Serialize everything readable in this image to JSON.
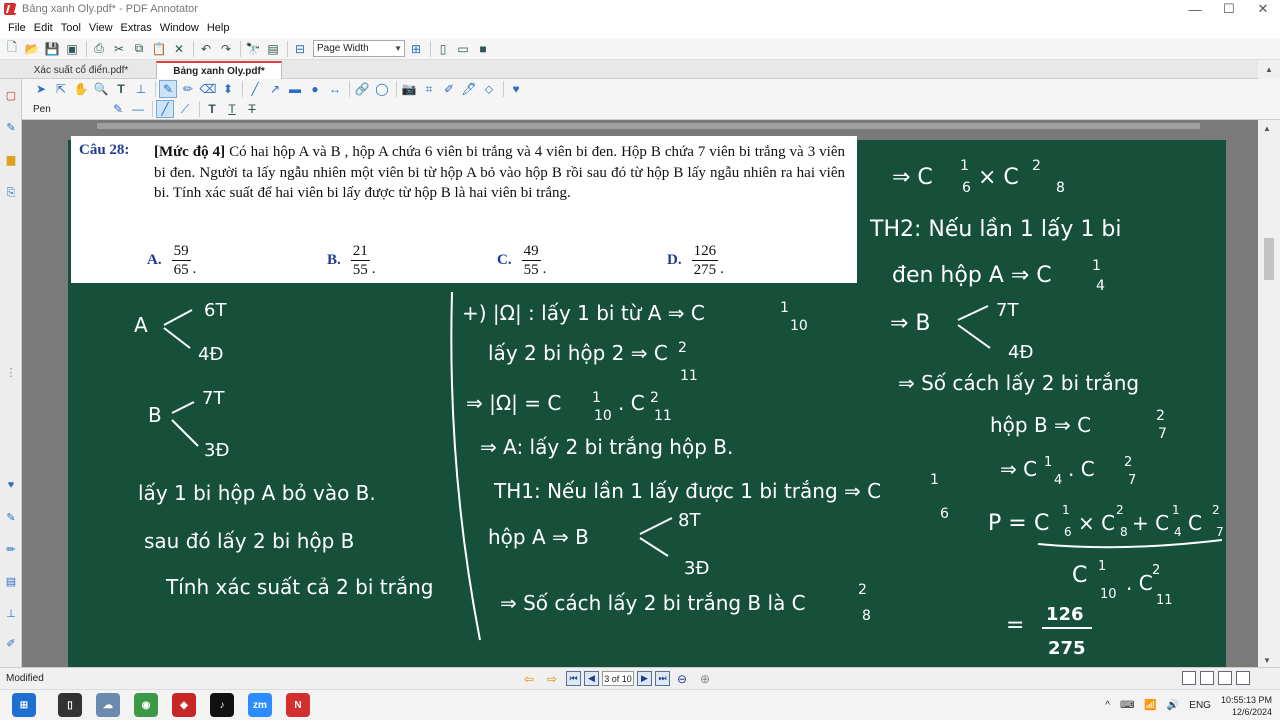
{
  "window": {
    "title": "Bảng xanh Oly.pdf* - PDF Annotator",
    "controls": [
      "—",
      "☐",
      "✕"
    ]
  },
  "menu": [
    "File",
    "Edit",
    "Tool",
    "View",
    "Extras",
    "Window",
    "Help"
  ],
  "toolbar": {
    "zoom": "Page Width"
  },
  "tabs": [
    {
      "label": "Xác suất cổ điển.pdf*"
    },
    {
      "label": "Bảng xanh Oly.pdf*"
    }
  ],
  "tool_label": "Pen",
  "question": {
    "number": "Câu 28:",
    "level": "[Mức độ 4]",
    "text": "Có hai hộp A và B , hộp A chứa 6 viên bi trắng và 4 viên bi đen. Hộp B chứa 7 viên bi trắng và 3 viên bi đen. Người ta lấy ngẫu nhiên một viên bi từ hộp A bỏ vào hộp B rồi sau đó từ hộp B lấy ngẫu nhiên ra hai viên bi. Tính xác suất để hai viên bi lấy được từ hộp B là hai viên bi trắng.",
    "answers": [
      {
        "letter": "A.",
        "num": "59",
        "den": "65"
      },
      {
        "letter": "B.",
        "num": "21",
        "den": "55"
      },
      {
        "letter": "C.",
        "num": "49",
        "den": "55"
      },
      {
        "letter": "D.",
        "num": "126",
        "den": "275"
      }
    ]
  },
  "notes": {
    "left": [
      "A",
      "6T",
      "4Đ",
      "B",
      "7T",
      "3Đ",
      "lấy 1 bi hộp A bỏ vào B.",
      "sau đó lấy 2 bi hộp B",
      "Tính xác suất cả 2 bi trắng"
    ],
    "middle": [
      "+) |Ω| : lấy 1 bi từ A ⇒ C",
      "1",
      "10",
      "lấy 2 bi hộp 2 ⇒ C",
      "2",
      "11",
      "⇒ |Ω| = C",
      "1",
      "10",
      ". C",
      "2",
      "11",
      "⇒ A: lấy 2 bi trắng hộp B.",
      "TH1: Nếu lần 1 lấy được 1 bi trắng ⇒ C",
      "1",
      "6",
      "hộp A ⇒ B",
      "8T",
      "3Đ",
      "⇒ Số cách lấy 2 bi trắng B là C",
      "2",
      "8"
    ],
    "right": [
      "⇒ C",
      "1",
      "6",
      "× C",
      "2",
      "8",
      "TH2: Nếu lần 1 lấy 1 bi",
      "đen hộp A ⇒ C",
      "1",
      "4",
      "⇒ B",
      "7T",
      "4Đ",
      "⇒ Số cách lấy 2 bi trắng",
      "hộp B ⇒ C",
      "2",
      "7",
      "⇒ C",
      "1",
      "4",
      ". C",
      "2",
      "7",
      "P =",
      "C",
      "1",
      "6",
      "× C",
      "2",
      "8",
      "+ C",
      "1",
      "4",
      "C",
      "2",
      "7",
      "C",
      "1",
      "10",
      ". C",
      "2",
      "11",
      "=",
      "126",
      "275"
    ]
  },
  "status": {
    "text": "Modified",
    "page": "3 of 10"
  },
  "taskbar": {
    "tray": {
      "lang": "ENG",
      "time": "10:55:13 PM",
      "date": "12/6/2024"
    }
  }
}
